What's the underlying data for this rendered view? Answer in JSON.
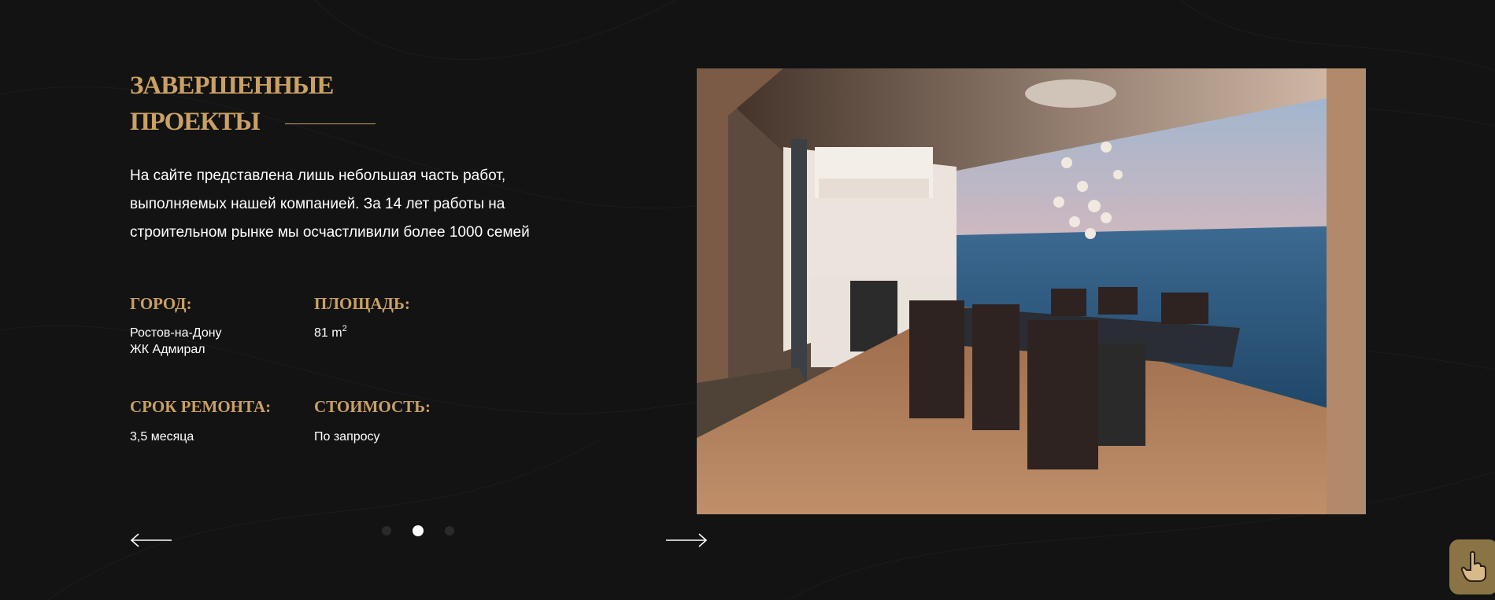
{
  "section": {
    "title_line1": "ЗАВЕРШЕННЫЕ",
    "title_line2": "ПРОЕКТЫ",
    "description": "На сайте представлена лишь небольшая часть работ, выполняемых нашей компанией. За 14 лет работы на строительном рынке мы осчастливили более 1000 семей"
  },
  "specs": {
    "city_label": "ГОРОД:",
    "city_line1": "Ростов-на-Дону",
    "city_line2": "ЖК Адмирал",
    "area_label": "ПЛОЩАДЬ:",
    "area_value": "81 m",
    "area_unit_sup": "2",
    "term_label": "СРОК РЕМОНТА:",
    "term_value": "3,5 месяца",
    "price_label": "СТОИМОСТЬ:",
    "price_value": "По запросу"
  },
  "slider": {
    "total_slides": 3,
    "active_slide": 2,
    "prev_icon": "arrow-left-icon",
    "next_icon": "arrow-right-icon"
  },
  "photo": {
    "subject": "dining room with panoramic glass wall overlooking the sea"
  },
  "widget": {
    "icon": "pointing-hand-icon"
  },
  "colors": {
    "background": "#131313",
    "accent_gold": "#caa063",
    "text": "#ffffff",
    "dot_inactive": "#2a2a2a",
    "widget_bg": "#8a7345"
  }
}
